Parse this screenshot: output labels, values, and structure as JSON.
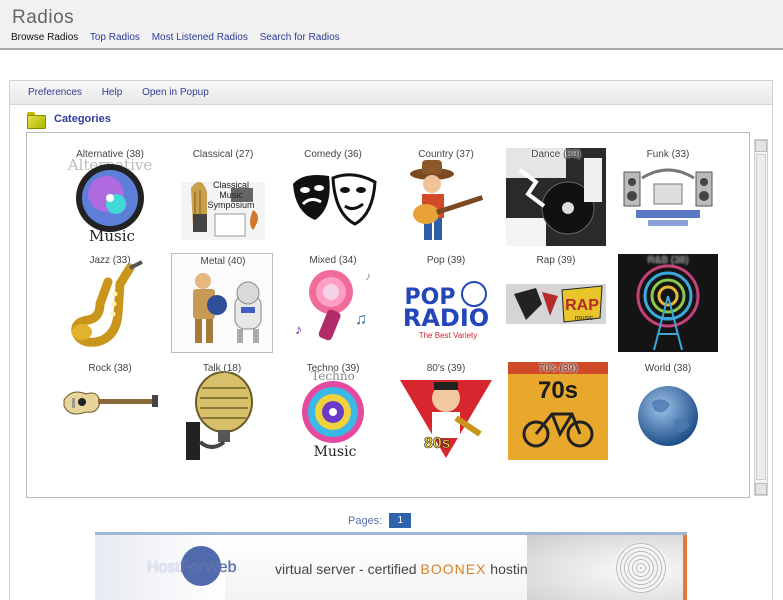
{
  "app": {
    "title": "Radios"
  },
  "nav": {
    "items": [
      {
        "label": "Browse Radios",
        "active": true
      },
      {
        "label": "Top Radios"
      },
      {
        "label": "Most Listened Radios"
      },
      {
        "label": "Search for Radios"
      }
    ]
  },
  "toolbar": {
    "items": [
      {
        "label": "Preferences"
      },
      {
        "label": "Help"
      },
      {
        "label": "Open in Popup"
      }
    ]
  },
  "categories": {
    "title": "Categories",
    "items": [
      {
        "label": "Alternative (38)",
        "icon": "alternative-disc-icon"
      },
      {
        "label": "Classical (27)",
        "icon": "classical-harp-icon"
      },
      {
        "label": "Comedy (36)",
        "icon": "comedy-masks-icon"
      },
      {
        "label": "Country (37)",
        "icon": "country-guitar-icon"
      },
      {
        "label": "Dance (39)",
        "icon": "dance-turntable-icon"
      },
      {
        "label": "Funk (33)",
        "icon": "funk-stage-icon"
      },
      {
        "label": "Jazz (33)",
        "icon": "jazz-saxophone-icon"
      },
      {
        "label": "Metal (40)",
        "icon": "metal-robot-icon"
      },
      {
        "label": "Mixed (34)",
        "icon": "mixed-notes-icon"
      },
      {
        "label": "Pop (39)",
        "icon": "pop-radio-logo-icon"
      },
      {
        "label": "Rap (39)",
        "icon": "rap-music-icon"
      },
      {
        "label": "R&B (38)",
        "icon": "rnb-tower-icon"
      },
      {
        "label": "Rock (38)",
        "icon": "rock-guitar-icon"
      },
      {
        "label": "Talk (18)",
        "icon": "talk-microphone-icon"
      },
      {
        "label": "Techno (39)",
        "icon": "techno-disc-icon"
      },
      {
        "label": "80's (39)",
        "icon": "eighties-figure-icon"
      },
      {
        "label": "70's (39)",
        "icon": "seventies-bicycle-icon"
      },
      {
        "label": "World (38)",
        "icon": "world-globe-icon"
      }
    ]
  },
  "tile_text": {
    "alt_word": "Alternative",
    "music": "Music",
    "classical_1": "Classical",
    "classical_2": "Music",
    "classical_3": "Symposium",
    "pop_1": "POP",
    "pop_2": "RADIO",
    "pop_3": "The Best Variety",
    "rap_1": "RAP",
    "rap_2": "music",
    "techno_word": "Techno",
    "eighties": "80s",
    "seventies": "70s"
  },
  "pagination": {
    "label": "Pages:",
    "current": "1"
  },
  "banner": {
    "brand_a": "Host",
    "brand_b": "ForWeb",
    "tagline_a": "virtual server - certified ",
    "tagline_brand": "BOONEX",
    "tagline_b": " hosting platform"
  },
  "colors": {
    "link": "#2f3d99",
    "page_button": "#2f64ad"
  }
}
